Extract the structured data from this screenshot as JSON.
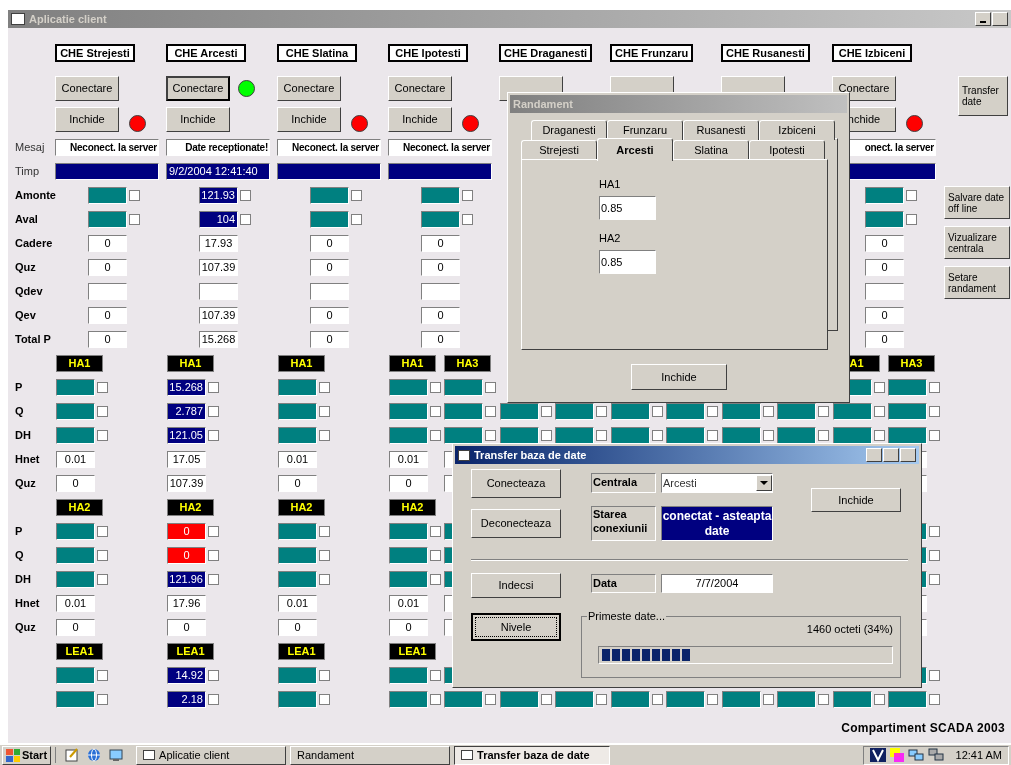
{
  "window": {
    "title": "Aplicatie client"
  },
  "labels": [
    {
      "kind": "plain",
      "text": "Mesaj"
    },
    {
      "kind": "plain",
      "text": "Timp"
    },
    {
      "kind": "bold",
      "text": "Amonte"
    },
    {
      "kind": "bold",
      "text": "Aval"
    },
    {
      "kind": "bold",
      "text": "Cadere"
    },
    {
      "kind": "bold",
      "text": "Quz"
    },
    {
      "kind": "bold",
      "text": "Qdev"
    },
    {
      "kind": "bold",
      "text": "Qev"
    },
    {
      "kind": "bold",
      "text": "Total P"
    },
    {
      "kind": "blank"
    },
    {
      "kind": "bold",
      "text": "P"
    },
    {
      "kind": "bold",
      "text": "Q"
    },
    {
      "kind": "bold",
      "text": "DH"
    },
    {
      "kind": "bold",
      "text": "Hnet"
    },
    {
      "kind": "bold",
      "text": "Quz"
    },
    {
      "kind": "blank"
    },
    {
      "kind": "bold",
      "text": "P"
    },
    {
      "kind": "bold",
      "text": "Q"
    },
    {
      "kind": "bold",
      "text": "DH"
    },
    {
      "kind": "bold",
      "text": "Hnet"
    },
    {
      "kind": "bold",
      "text": "Quz"
    }
  ],
  "stations": [
    {
      "name": "CHE Strejesti",
      "connected": false,
      "conectare": "Conectare",
      "inchide": "Inchide",
      "mesaj": "Neconect. la server",
      "measures": [
        {
          "kind": "indicator",
          "checked": false
        },
        {
          "kind": "indicator",
          "checked": false
        },
        {
          "kind": "field",
          "text": "0"
        },
        {
          "kind": "field",
          "text": "0"
        },
        {
          "kind": "field"
        },
        {
          "kind": "field",
          "text": "0"
        },
        {
          "kind": "field",
          "text": "0"
        }
      ],
      "groups": [
        {
          "units": [
            {
              "label": "HA1",
              "cells": [
                {
                  "kind": "indicator",
                  "checked": false
                },
                {
                  "kind": "indicator",
                  "checked": false
                },
                {
                  "kind": "indicator",
                  "checked": false
                },
                {
                  "kind": "field",
                  "text": "0.01"
                },
                {
                  "kind": "field",
                  "text": "0"
                }
              ]
            }
          ]
        },
        {
          "units": [
            {
              "label": "HA2",
              "cells": [
                {
                  "kind": "indicator",
                  "checked": false
                },
                {
                  "kind": "indicator",
                  "checked": false
                },
                {
                  "kind": "indicator",
                  "checked": false
                },
                {
                  "kind": "field",
                  "text": "0.01"
                },
                {
                  "kind": "field",
                  "text": "0"
                }
              ]
            }
          ]
        },
        {
          "units": [
            {
              "label": "LEA1",
              "cells": [
                {
                  "kind": "indicator",
                  "checked": false
                },
                {
                  "kind": "indicator",
                  "checked": false
                }
              ]
            }
          ]
        }
      ]
    },
    {
      "name": "CHE Arcesti",
      "connected": true,
      "conectare": "Conectare",
      "inchide": "Inchide",
      "mesaj": "Date receptionate!",
      "timp": "9/2/2004 12:41:40",
      "measures": [
        {
          "kind": "value",
          "text": "121.93",
          "checked": false
        },
        {
          "kind": "value",
          "text": "104",
          "checked": false
        },
        {
          "kind": "field",
          "text": "17.93"
        },
        {
          "kind": "field",
          "text": "107.39"
        },
        {
          "kind": "field"
        },
        {
          "kind": "field",
          "text": "107.39"
        },
        {
          "kind": "field",
          "text": "15.268"
        }
      ],
      "groups": [
        {
          "units": [
            {
              "label": "HA1",
              "cells": [
                {
                  "kind": "value",
                  "text": "15.268",
                  "checked": false
                },
                {
                  "kind": "value",
                  "text": "2.787",
                  "checked": false
                },
                {
                  "kind": "value",
                  "text": "121.05",
                  "checked": false
                },
                {
                  "kind": "field",
                  "text": "17.05"
                },
                {
                  "kind": "field",
                  "text": "107.39"
                }
              ]
            }
          ]
        },
        {
          "units": [
            {
              "label": "HA2",
              "cells": [
                {
                  "kind": "alarm",
                  "text": "0",
                  "checked": false
                },
                {
                  "kind": "alarm",
                  "text": "0",
                  "checked": false
                },
                {
                  "kind": "value",
                  "text": "121.96",
                  "checked": false
                },
                {
                  "kind": "field",
                  "text": "17.96"
                },
                {
                  "kind": "field",
                  "text": "0"
                }
              ]
            }
          ]
        },
        {
          "units": [
            {
              "label": "LEA1",
              "cells": [
                {
                  "kind": "value",
                  "text": "14.92",
                  "checked": false
                },
                {
                  "kind": "value",
                  "text": "2.18",
                  "checked": false
                }
              ]
            }
          ]
        }
      ]
    },
    {
      "name": "CHE Slatina",
      "connected": false,
      "conectare": "Conectare",
      "inchide": "Inchide",
      "mesaj": "Neconect. la server",
      "measures": [
        {
          "kind": "indicator",
          "checked": false
        },
        {
          "kind": "indicator",
          "checked": false
        },
        {
          "kind": "field",
          "text": "0"
        },
        {
          "kind": "field",
          "text": "0"
        },
        {
          "kind": "field"
        },
        {
          "kind": "field",
          "text": "0"
        },
        {
          "kind": "field",
          "text": "0"
        }
      ],
      "groups": [
        {
          "units": [
            {
              "label": "HA1",
              "cells": [
                {
                  "kind": "indicator",
                  "checked": false
                },
                {
                  "kind": "indicator",
                  "checked": false
                },
                {
                  "kind": "indicator",
                  "checked": false
                },
                {
                  "kind": "field",
                  "text": "0.01"
                },
                {
                  "kind": "field",
                  "text": "0"
                }
              ]
            }
          ]
        },
        {
          "units": [
            {
              "label": "HA2",
              "cells": [
                {
                  "kind": "indicator",
                  "checked": false
                },
                {
                  "kind": "indicator",
                  "checked": false
                },
                {
                  "kind": "indicator",
                  "checked": false
                },
                {
                  "kind": "field",
                  "text": "0.01"
                },
                {
                  "kind": "field",
                  "text": "0"
                }
              ]
            }
          ]
        },
        {
          "units": [
            {
              "label": "LEA1",
              "cells": [
                {
                  "kind": "indicator",
                  "checked": false
                },
                {
                  "kind": "indicator",
                  "checked": false
                }
              ]
            }
          ]
        }
      ]
    },
    {
      "name": "CHE Ipotesti",
      "connected": false,
      "conectare": "Conectare",
      "inchide": "Inchide",
      "mesaj": "Neconect. la server",
      "measures": [
        {
          "kind": "indicator",
          "checked": false
        },
        {
          "kind": "indicator",
          "checked": false
        },
        {
          "kind": "field",
          "text": "0"
        },
        {
          "kind": "field",
          "text": "0"
        },
        {
          "kind": "field"
        },
        {
          "kind": "field",
          "text": "0"
        },
        {
          "kind": "field",
          "text": "0"
        }
      ],
      "groups": [
        {
          "units": [
            {
              "label": "HA1",
              "cells": [
                {
                  "kind": "indicator",
                  "checked": false
                },
                {
                  "kind": "indicator",
                  "checked": false
                },
                {
                  "kind": "indicator",
                  "checked": false
                },
                {
                  "kind": "field",
                  "text": "0.01"
                },
                {
                  "kind": "field",
                  "text": "0"
                }
              ]
            },
            {
              "label": "HA3",
              "cells": [
                {
                  "kind": "indicator",
                  "checked": false
                },
                {
                  "kind": "indicator",
                  "checked": false
                },
                {
                  "kind": "indicator",
                  "checked": false
                },
                {
                  "kind": "field"
                },
                {
                  "kind": "field"
                }
              ]
            }
          ]
        },
        {
          "units": [
            {
              "label": "HA2",
              "cells": [
                {
                  "kind": "indicator",
                  "checked": false
                },
                {
                  "kind": "indicator",
                  "checked": false
                },
                {
                  "kind": "indicator",
                  "checked": false
                },
                {
                  "kind": "field",
                  "text": "0.01"
                },
                {
                  "kind": "field",
                  "text": "0"
                }
              ]
            },
            {
              "cells": [
                {
                  "kind": "indicator"
                },
                {
                  "kind": "indicator"
                },
                {
                  "kind": "indicator"
                },
                {
                  "kind": "field"
                },
                {
                  "kind": "field"
                }
              ]
            }
          ]
        },
        {
          "units": [
            {
              "label": "LEA1",
              "cells": [
                {
                  "kind": "indicator",
                  "checked": false
                },
                {
                  "kind": "indicator",
                  "checked": false
                }
              ]
            },
            {
              "cells": [
                {
                  "kind": "indicator"
                },
                {
                  "kind": "indicator",
                  "checked": false
                }
              ]
            }
          ]
        }
      ]
    },
    {
      "name": "CHE Draganesti",
      "groups": [
        {
          "units": [
            {
              "cells": [
                null,
                {
                  "kind": "indicator",
                  "checked": false
                },
                {
                  "kind": "indicator",
                  "checked": false
                },
                null,
                null
              ]
            },
            {
              "cells": [
                null,
                {
                  "kind": "indicator",
                  "checked": false
                },
                {
                  "kind": "indicator",
                  "checked": false
                },
                null,
                null
              ]
            }
          ]
        },
        {
          "units": [
            {
              "cells": [
                null,
                null,
                null,
                null,
                null
              ]
            },
            {
              "cells": [
                null,
                null,
                null,
                null,
                null
              ]
            }
          ]
        },
        {
          "units": [
            {
              "cells": [
                null,
                {
                  "kind": "indicator",
                  "checked": false
                }
              ]
            },
            {
              "cells": [
                null,
                {
                  "kind": "indicator",
                  "checked": false
                }
              ]
            }
          ]
        }
      ]
    },
    {
      "name": "CHE Frunzaru",
      "groups": [
        {
          "units": [
            {
              "cells": [
                null,
                {
                  "kind": "indicator",
                  "checked": false
                },
                {
                  "kind": "indicator",
                  "checked": false
                },
                null,
                null
              ]
            },
            {
              "cells": [
                null,
                {
                  "kind": "indicator",
                  "checked": false
                },
                {
                  "kind": "indicator",
                  "checked": false
                },
                null,
                null
              ]
            }
          ]
        },
        {
          "units": [
            {
              "cells": [
                null,
                null,
                null,
                null,
                null
              ]
            },
            {
              "cells": [
                null,
                null,
                null,
                null,
                null
              ]
            }
          ]
        },
        {
          "units": [
            {
              "cells": [
                null,
                {
                  "kind": "indicator",
                  "checked": false
                }
              ]
            },
            {
              "cells": [
                null,
                {
                  "kind": "indicator",
                  "checked": false
                }
              ]
            }
          ]
        }
      ]
    },
    {
      "name": "CHE Rusanesti",
      "groups": [
        {
          "units": [
            {
              "cells": [
                null,
                {
                  "kind": "indicator",
                  "checked": false
                },
                {
                  "kind": "indicator",
                  "checked": false
                },
                null,
                null
              ]
            },
            {
              "cells": [
                null,
                {
                  "kind": "indicator",
                  "checked": false
                },
                {
                  "kind": "indicator",
                  "checked": false
                },
                null,
                null
              ]
            }
          ]
        },
        {
          "units": [
            {
              "cells": [
                null,
                null,
                null,
                null,
                null
              ]
            },
            {
              "cells": [
                null,
                null,
                null,
                null,
                null
              ]
            }
          ]
        },
        {
          "units": [
            {
              "cells": [
                null,
                {
                  "kind": "indicator",
                  "checked": false
                }
              ]
            },
            {
              "cells": [
                null,
                {
                  "kind": "indicator",
                  "checked": false
                }
              ]
            }
          ]
        }
      ]
    },
    {
      "name": "CHE Izbiceni",
      "connected": false,
      "conectare": "Conectare",
      "inchide": "nchide",
      "mesaj": "onect. la server",
      "measures": [
        {
          "kind": "indicator",
          "checked": false
        },
        {
          "kind": "indicator",
          "checked": false
        },
        {
          "kind": "field",
          "text": "0"
        },
        {
          "kind": "field",
          "text": "0"
        },
        {
          "kind": "field"
        },
        {
          "kind": "field",
          "text": "0"
        },
        {
          "kind": "field",
          "text": "0"
        }
      ],
      "groups": [
        {
          "units": [
            {
              "label": "A1",
              "cells": [
                {
                  "kind": "indicator",
                  "checked": false
                },
                {
                  "kind": "indicator",
                  "checked": false
                },
                {
                  "kind": "indicator",
                  "checked": false
                },
                null,
                null
              ]
            },
            {
              "label": "HA3",
              "cells": [
                {
                  "kind": "indicator",
                  "checked": false
                },
                {
                  "kind": "indicator",
                  "checked": false
                },
                {
                  "kind": "indicator",
                  "checked": false
                },
                {
                  "kind": "field"
                },
                {
                  "kind": "field"
                }
              ]
            }
          ]
        },
        {
          "units": [
            {
              "cells": [
                null,
                null,
                null,
                null,
                null
              ]
            },
            {
              "cells": [
                {
                  "kind": "indicator",
                  "checked": false
                },
                {
                  "kind": "indicator",
                  "checked": false
                },
                {
                  "kind": "indicator",
                  "checked": false
                },
                {
                  "kind": "field"
                },
                {
                  "kind": "field"
                }
              ]
            }
          ]
        },
        {
          "units": [
            {
              "cells": [
                null,
                {
                  "kind": "indicator",
                  "checked": false
                }
              ]
            },
            {
              "cells": [
                {
                  "kind": "indicator",
                  "checked": false
                },
                {
                  "kind": "indicator",
                  "checked": false
                }
              ]
            }
          ]
        }
      ]
    }
  ],
  "side_buttons": [
    "Transfer date",
    "Salvare date off line",
    "Vizualizare centrala",
    "Setare randament"
  ],
  "footer": "Compartiment SCADA 2003",
  "randament": {
    "title": "Randament",
    "tab_rows": [
      {
        "tabs": [
          {
            "label": "Draganesti",
            "selected": false
          },
          {
            "label": "Frunzaru",
            "selected": false
          },
          {
            "label": "Rusanesti",
            "selected": false
          },
          {
            "label": "Izbiceni",
            "selected": false
          }
        ]
      },
      {
        "tabs": [
          {
            "label": "Strejesti",
            "selected": false
          },
          {
            "label": "Arcesti",
            "selected": true
          },
          {
            "label": "Slatina",
            "selected": false
          },
          {
            "label": "Ipotesti",
            "selected": false
          }
        ]
      }
    ],
    "fields": [
      {
        "label": "HA1",
        "value": "0.85"
      },
      {
        "label": "HA2",
        "value": "0.85"
      }
    ],
    "button": "Inchide"
  },
  "transfer": {
    "title": "Transfer baza de date",
    "buttons": [
      {
        "label": "Conecteaza",
        "focused": false
      },
      {
        "label": "Deconecteaza",
        "focused": false
      },
      {
        "label": "Indecsi",
        "focused": false
      },
      {
        "label": "Nivele",
        "focused": true
      }
    ],
    "close_button": "Inchide",
    "centrala": {
      "label": "Centrala",
      "value": "Arcesti"
    },
    "starea": {
      "label": "Starea conexiunii",
      "value": "conectat - asteapta date"
    },
    "data": {
      "label": "Data",
      "value": "7/7/2004"
    },
    "progress": {
      "title": "Primeste date...",
      "reading": "1460 octeti (34%)",
      "level": 0.34
    }
  },
  "taskbar": {
    "start": "Start",
    "buttons": [
      {
        "label": "Aplicatie client",
        "selected": false
      },
      {
        "label": "Randament",
        "selected": false
      },
      {
        "label": "Transfer baza de date",
        "selected": true
      }
    ],
    "clock": "12:41 AM"
  }
}
